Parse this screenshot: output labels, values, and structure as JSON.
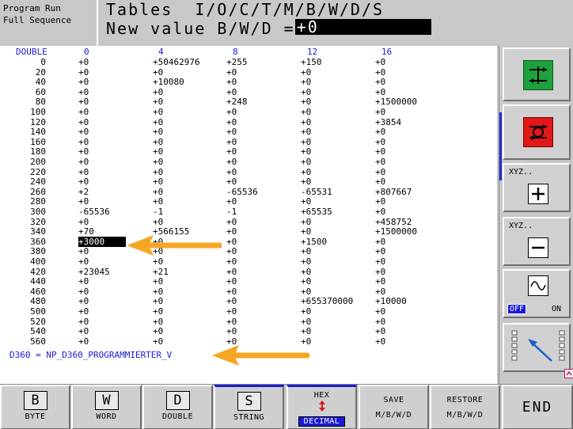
{
  "header": {
    "mode_line1": "Program Run",
    "mode_line2": "Full Sequence",
    "title": "Tables  I/O/C/T/M/B/W/D/S",
    "prompt": "New value B/W/D =",
    "input_value": "+0"
  },
  "table": {
    "headers": [
      "DOUBLE",
      "0",
      "4",
      "8",
      "12",
      "16"
    ],
    "rows": [
      [
        "0",
        "+0",
        "+50462976",
        "+255",
        "+150",
        "+0"
      ],
      [
        "20",
        "+0",
        "+0",
        "+0",
        "+0",
        "+0"
      ],
      [
        "40",
        "+0",
        "+10080",
        "+0",
        "+0",
        "+0"
      ],
      [
        "60",
        "+0",
        "+0",
        "+0",
        "+0",
        "+0"
      ],
      [
        "80",
        "+0",
        "+0",
        "+248",
        "+0",
        "+1500000"
      ],
      [
        "100",
        "+0",
        "+0",
        "+0",
        "+0",
        "+0"
      ],
      [
        "120",
        "+0",
        "+0",
        "+0",
        "+0",
        "+3854"
      ],
      [
        "140",
        "+0",
        "+0",
        "+0",
        "+0",
        "+0"
      ],
      [
        "160",
        "+0",
        "+0",
        "+0",
        "+0",
        "+0"
      ],
      [
        "180",
        "+0",
        "+0",
        "+0",
        "+0",
        "+0"
      ],
      [
        "200",
        "+0",
        "+0",
        "+0",
        "+0",
        "+0"
      ],
      [
        "220",
        "+0",
        "+0",
        "+0",
        "+0",
        "+0"
      ],
      [
        "240",
        "+0",
        "+0",
        "+0",
        "+0",
        "+0"
      ],
      [
        "260",
        "+2",
        "+0",
        "-65536",
        "-65531",
        "+807667"
      ],
      [
        "280",
        "+0",
        "+0",
        "+0",
        "+0",
        "+0"
      ],
      [
        "300",
        "-65536",
        "-1",
        "-1",
        "+65535",
        "+0"
      ],
      [
        "320",
        "+0",
        "+0",
        "+0",
        "+0",
        "+458752"
      ],
      [
        "340",
        "+70",
        "+566155",
        "+0",
        "+0",
        "+1500000"
      ],
      [
        "360",
        "+3000",
        "+0",
        "+0",
        "+1500",
        "+0"
      ],
      [
        "380",
        "+0",
        "+0",
        "+0",
        "+0",
        "+0"
      ],
      [
        "400",
        "+0",
        "+0",
        "+0",
        "+0",
        "+0"
      ],
      [
        "420",
        "+23045",
        "+21",
        "+0",
        "+0",
        "+0"
      ],
      [
        "440",
        "+0",
        "+0",
        "+0",
        "+0",
        "+0"
      ],
      [
        "460",
        "+0",
        "+0",
        "+0",
        "+0",
        "+0"
      ],
      [
        "480",
        "+0",
        "+0",
        "+0",
        "+655370000",
        "+10000"
      ],
      [
        "500",
        "+0",
        "+0",
        "+0",
        "+0",
        "+0"
      ],
      [
        "520",
        "+0",
        "+0",
        "+0",
        "+0",
        "+0"
      ],
      [
        "540",
        "+0",
        "+0",
        "+0",
        "+0",
        "+0"
      ],
      [
        "560",
        "+0",
        "+0",
        "+0",
        "+0",
        "+0"
      ]
    ],
    "selected_cell": "+3000",
    "status_line": "D360 = NP_D360_PROGRAMMIERTER_V"
  },
  "sidebar": {
    "xyz_plus_label": "XYZ..",
    "xyz_minus_label": "XYZ..",
    "toggle_off": "OFF",
    "toggle_on": "ON"
  },
  "softkeys": {
    "byte_key": "B",
    "byte_label": "BYTE",
    "word_key": "W",
    "word_label": "WORD",
    "double_key": "D",
    "double_label": "DOUBLE",
    "string_key": "S",
    "string_label": "STRING",
    "hex_label": "HEX",
    "decimal_label": "DECIMAL",
    "save_line1": "SAVE",
    "save_line2": "M/B/W/D",
    "restore_line1": "RESTORE",
    "restore_line2": "M/B/W/D",
    "end_label": "END"
  },
  "colors": {
    "accent_blue": "#1a1ad6",
    "arrow_orange": "#f5a623",
    "start_green": "#1ea03c",
    "stop_red": "#e01818"
  }
}
